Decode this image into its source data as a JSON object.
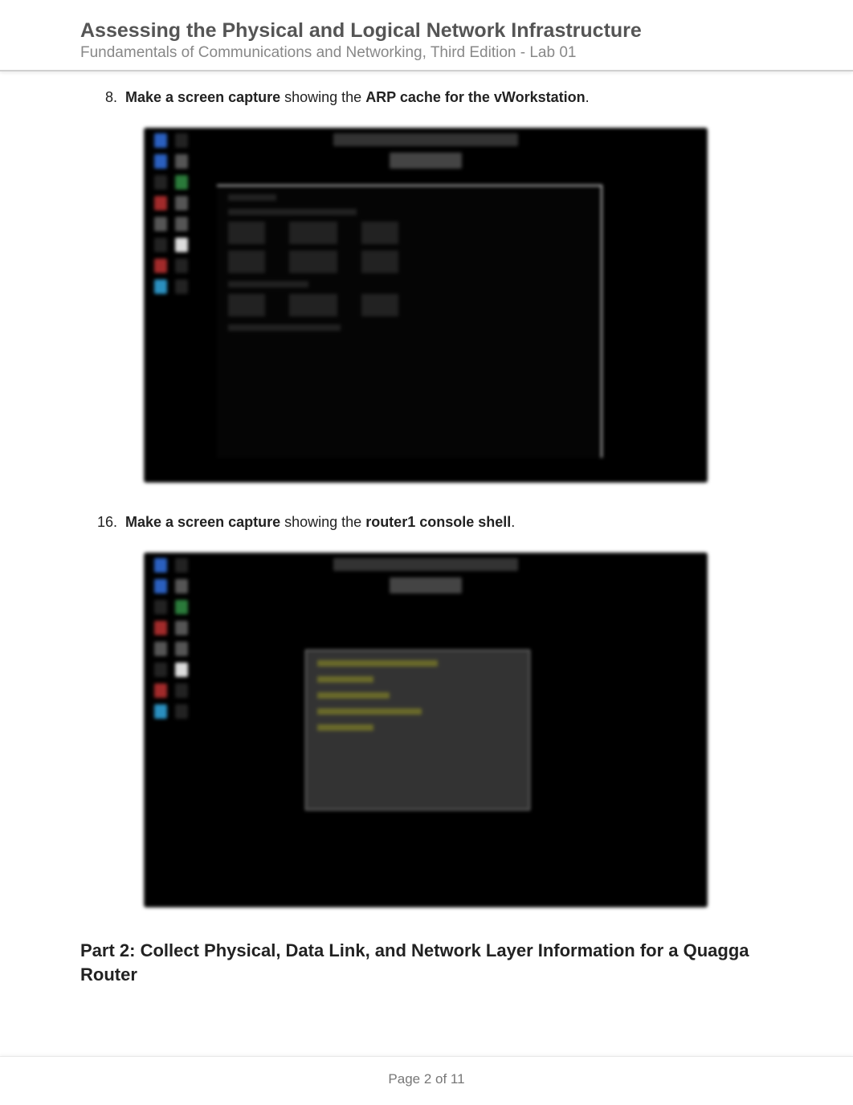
{
  "header": {
    "title": "Assessing the Physical and Logical Network Infrastructure",
    "subtitle": "Fundamentals of Communications and Networking, Third Edition - Lab 01"
  },
  "steps": [
    {
      "num": "8.",
      "bold_lead": "Make a screen capture",
      "mid": " showing the ",
      "bold_tail": "ARP cache for the vWorkstation",
      "tail": "."
    },
    {
      "num": "16.",
      "bold_lead": "Make a screen capture",
      "mid": " showing the ",
      "bold_tail": "router1 console shell",
      "tail": "."
    }
  ],
  "part_heading": "Part 2: Collect Physical, Data Link, and Network Layer Information for a Quagga Router",
  "footer": {
    "page_label": "Page 2 of 11"
  }
}
